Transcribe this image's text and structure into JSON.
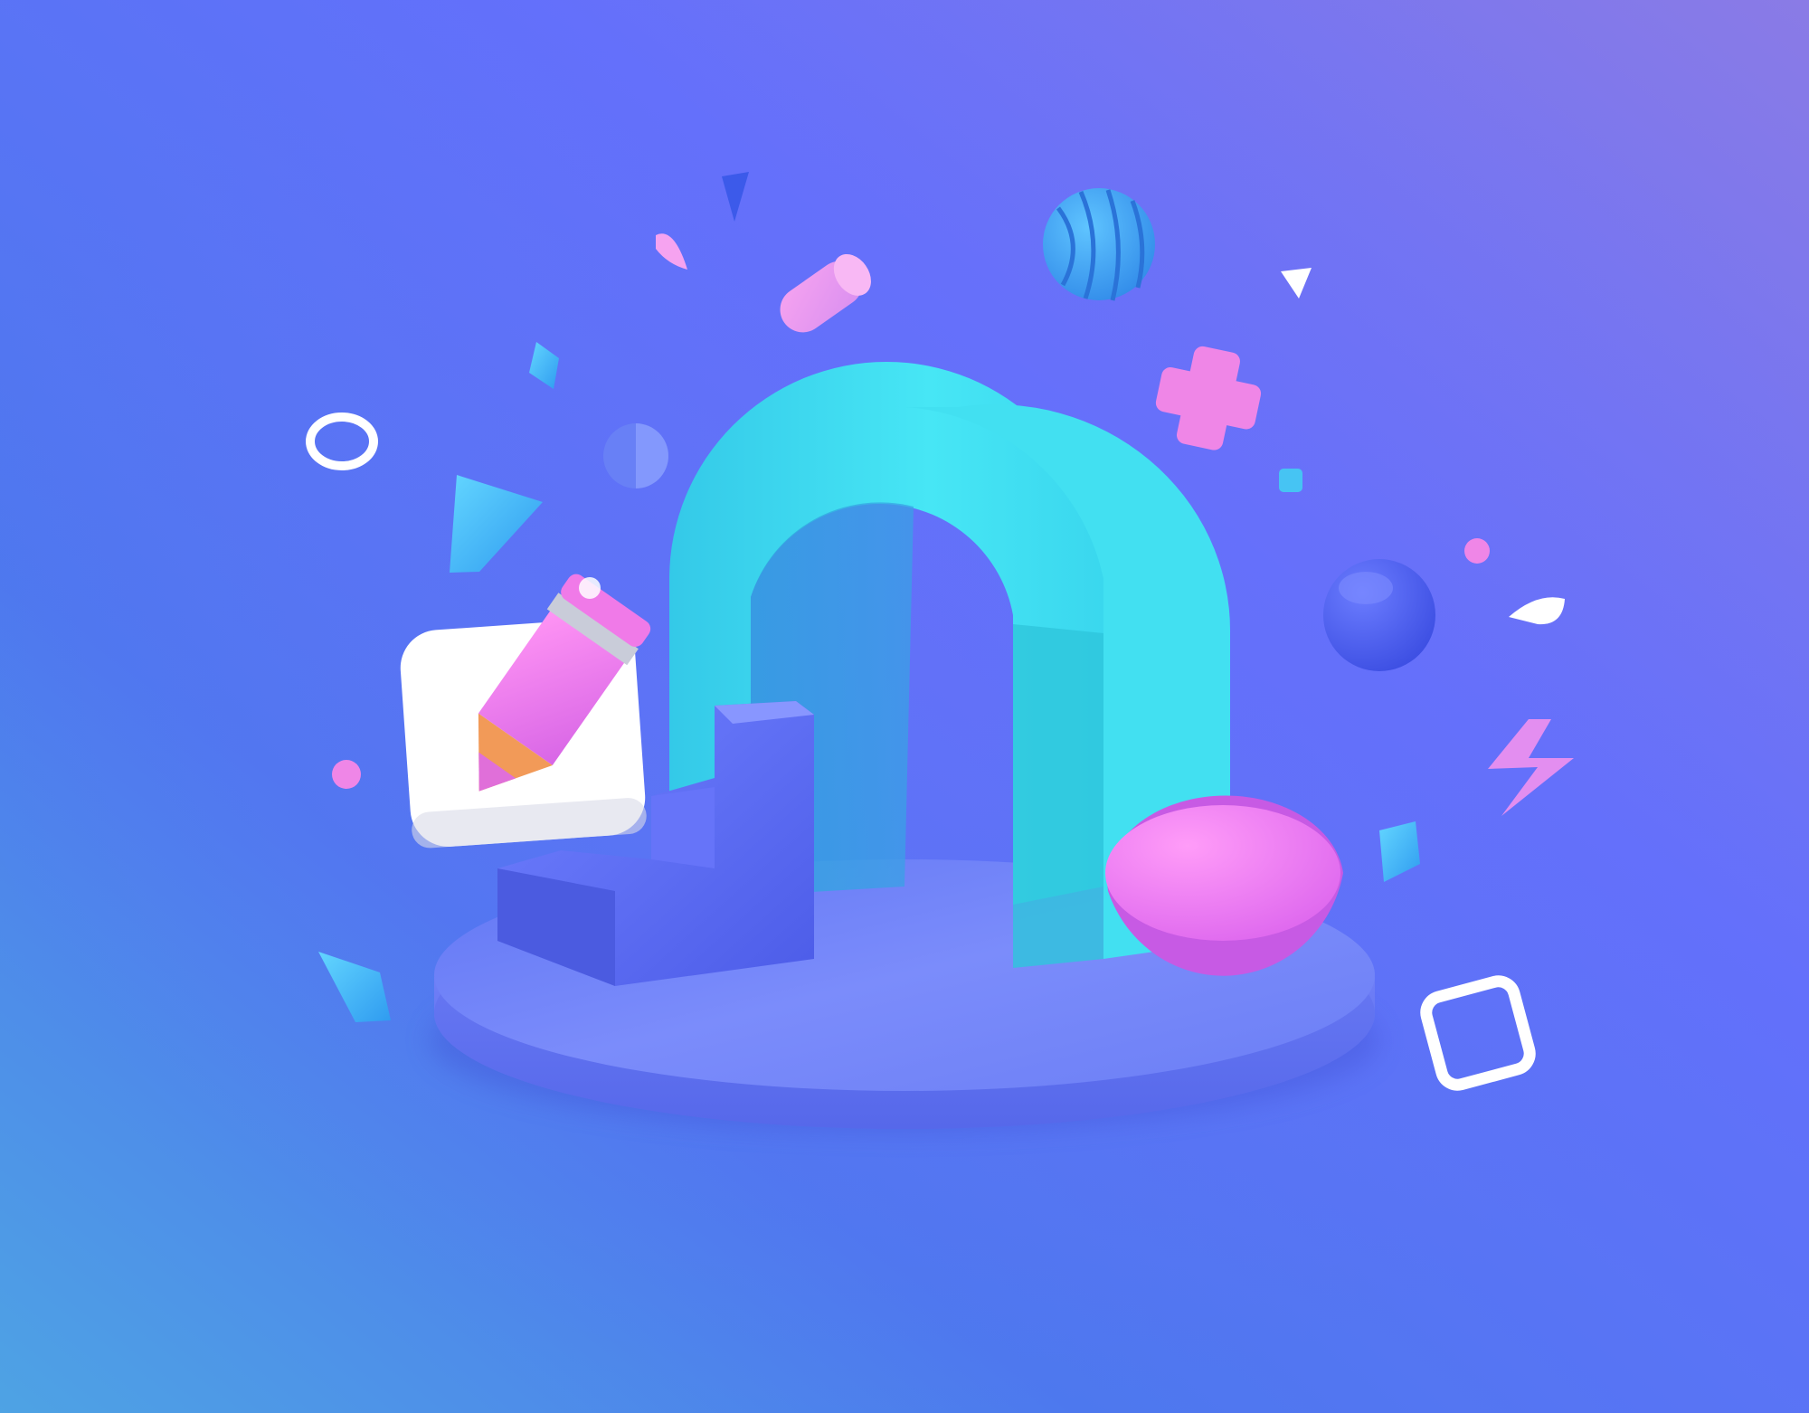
{
  "scene": {
    "kind": "3d-illustration",
    "icons": [
      "background",
      "platform",
      "arch",
      "stairs",
      "hemisphere",
      "pencil-app-icon",
      "ribbed-sphere",
      "plus-shape",
      "lightning-shape",
      "ring-shape",
      "rounded-square-outline",
      "glass-sphere",
      "cylinder"
    ],
    "colors": {
      "bg_top_right": "#8a7be6",
      "bg_mid": "#5b6cf6",
      "bg_bottom_left": "#4ea3e4",
      "platform": "#6f83f8",
      "platform_side": "#5a6cea",
      "arch": "#3fe0ee",
      "arch_shadow": "#2bbfd6",
      "stairs": "#5667f2",
      "stairs_light": "#7584ff",
      "hemisphere": "#f57ef2",
      "icon_tile": "#ffffff",
      "pencil_body": "#f07ae8",
      "pencil_tip": "#f29a58",
      "accent_pink": "#f28be9",
      "accent_cyan": "#46c4f3",
      "accent_blue": "#4a63ee"
    }
  }
}
